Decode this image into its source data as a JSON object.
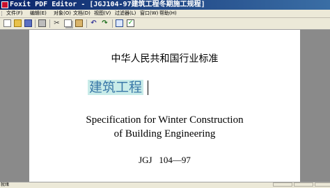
{
  "window": {
    "title": "Foxit PDF Editor - [JGJ104-97建筑工程冬期施工规程]"
  },
  "menubar": {
    "items": [
      "文件(F)",
      "编辑(E)",
      "对象(O)",
      "文档(D)",
      "视图(V)",
      "过滤器(L)",
      "窗口(W)",
      "帮助(H)"
    ]
  },
  "toolbar": {
    "icons": [
      "new-icon",
      "open-icon",
      "save-icon",
      "print-icon",
      "cut-icon",
      "copy-icon",
      "paste-icon",
      "undo-icon",
      "redo-icon",
      "properties-icon",
      "check-icon"
    ]
  },
  "document": {
    "title": "中华人民共和国行业标准",
    "subtitle": "建筑工程",
    "spec_line1": "Specification for Winter Construction",
    "spec_line2": "of Building Engineering",
    "standard_code": "JGJ   104—97"
  },
  "statusbar": {
    "text": "就绪"
  },
  "colors": {
    "title_bar": "#0a246a",
    "selection_highlight": "#c9ece9",
    "selected_text": "#3a78a8",
    "workspace": "#8a8a8a"
  }
}
